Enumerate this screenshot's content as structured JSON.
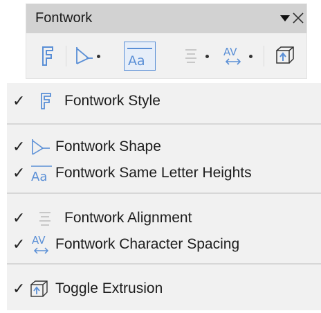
{
  "toolbar": {
    "title": "Fontwork",
    "menu_glyph": "▼",
    "close_glyph": "✕",
    "buttons": [
      {
        "icon": "fontwork-style-icon"
      },
      {
        "icon": "fontwork-shape-icon",
        "dropdown": true
      },
      {
        "icon": "same-letter-heights-icon",
        "active": true
      },
      {
        "icon": "alignment-icon",
        "dropdown": true
      },
      {
        "icon": "character-spacing-icon",
        "dropdown": true
      },
      {
        "icon": "toggle-extrusion-icon"
      }
    ]
  },
  "menu": {
    "items": [
      {
        "checked": true,
        "check_glyph": "✓",
        "icon": "fontwork-style-icon",
        "label": "Fontwork Style"
      },
      {
        "checked": true,
        "check_glyph": "✓",
        "icon": "fontwork-shape-icon",
        "label": "Fontwork Shape"
      },
      {
        "checked": true,
        "check_glyph": "✓",
        "icon": "same-letter-heights-icon",
        "label": "Fontwork Same Letter Heights"
      },
      {
        "checked": true,
        "check_glyph": "✓",
        "icon": "alignment-icon",
        "label": "Fontwork Alignment"
      },
      {
        "checked": true,
        "check_glyph": "✓",
        "icon": "character-spacing-icon",
        "label": "Fontwork Character Spacing"
      },
      {
        "checked": true,
        "check_glyph": "✓",
        "icon": "toggle-extrusion-icon",
        "label": "Toggle Extrusion"
      }
    ]
  },
  "colors": {
    "icon_blue": "#5a8fd6",
    "icon_gray": "#c8c8c8",
    "toolbar_title_bg": "#d2d2d2",
    "panel_bg": "#f1f1f1"
  }
}
